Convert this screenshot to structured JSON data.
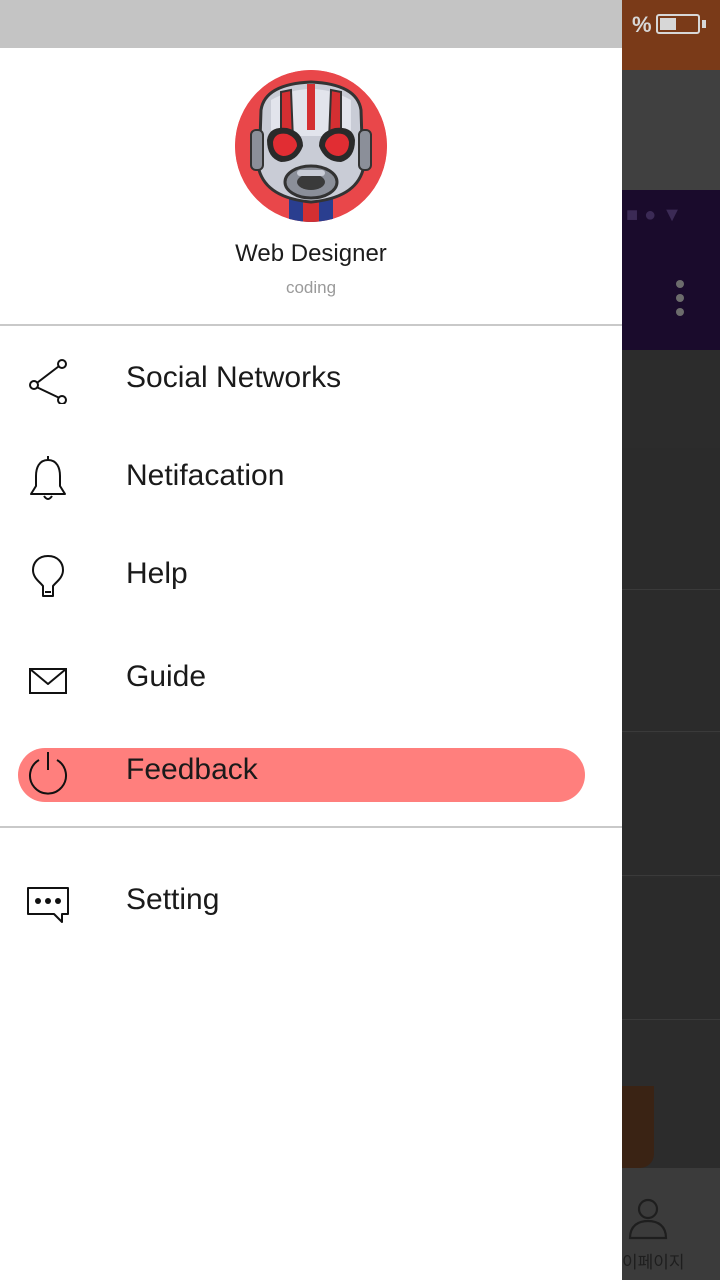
{
  "background": {
    "status_percent": "%",
    "battery_level": 0.45,
    "bottom_nav_label": "이페이지"
  },
  "profile": {
    "name": "Web Designer",
    "role": "coding",
    "avatar_icon": "superhero-helmet-avatar"
  },
  "menu": {
    "items": [
      {
        "label": "Social Networks",
        "icon": "share-icon"
      },
      {
        "label": "Netifacation",
        "icon": "bell-icon"
      },
      {
        "label": "Help",
        "icon": "lightbulb-icon"
      },
      {
        "label": "Guide",
        "icon": "mail-icon"
      },
      {
        "label": "Feedback",
        "icon": "power-icon",
        "active": true
      }
    ],
    "secondary_items": [
      {
        "label": "Setting",
        "icon": "chat-bubble-icon"
      }
    ]
  },
  "colors": {
    "active_pill": "#ff7f7d",
    "avatar_bg": "#e9474a",
    "status_bar": "#c4c4c4"
  }
}
